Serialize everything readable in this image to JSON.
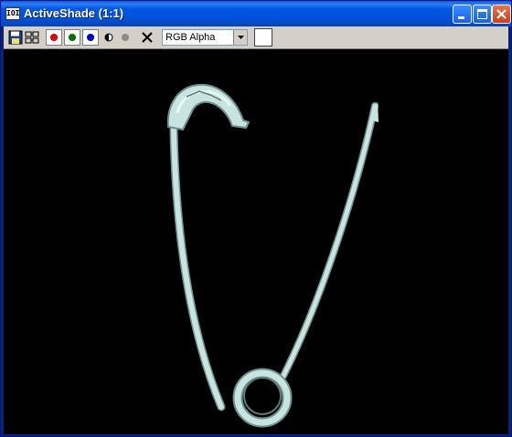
{
  "window": {
    "title": "ActiveShade (1:1)",
    "icon_label": "IOI"
  },
  "title_buttons": {
    "minimize_icon": "minimize-icon",
    "maximize_icon": "maximize-icon",
    "close_icon": "close-icon"
  },
  "toolbar": {
    "tools": [
      "save-icon",
      "clone-icon",
      "red-channel",
      "green-channel",
      "blue-channel",
      "monochrome-icon",
      "display-alpha-icon",
      "clear-icon"
    ],
    "channel_colors": {
      "red": "#e00000",
      "green": "#007000",
      "blue": "#0000d0"
    },
    "channel_select": {
      "value": "RGB Alpha"
    },
    "color_swatch": "#ffffff"
  },
  "viewport": {
    "background": "#000000",
    "object_color": "#c7e4e0"
  }
}
